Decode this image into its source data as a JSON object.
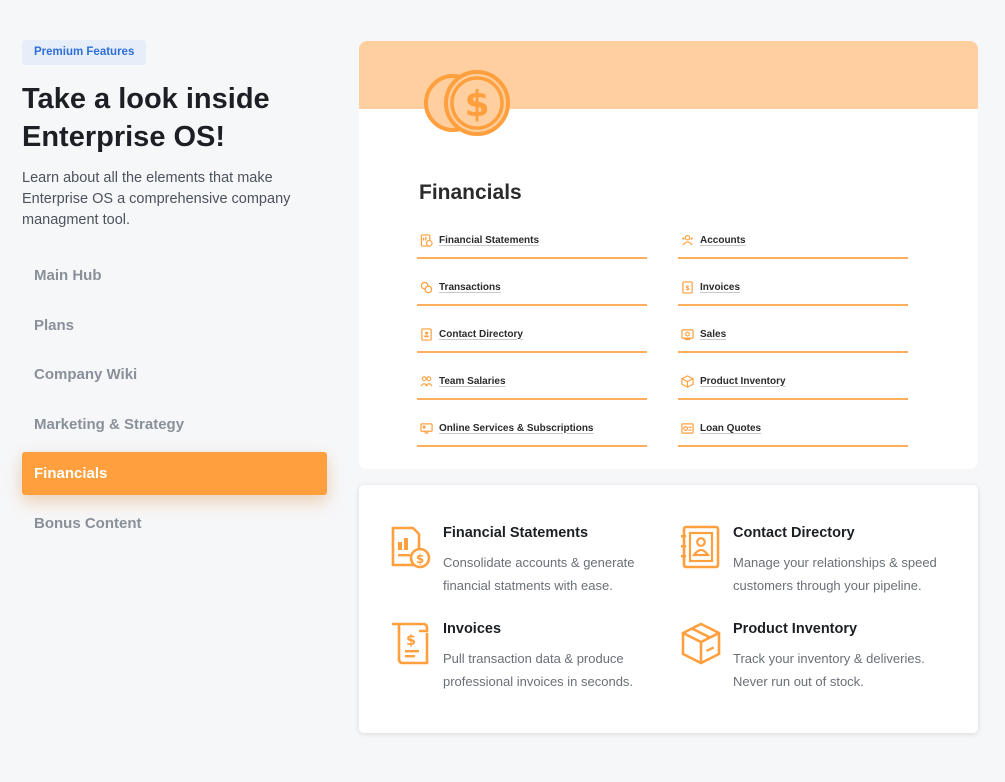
{
  "badge": "Premium Features",
  "heading": "Take a look inside Enterprise OS!",
  "intro": "Learn about all the elements that make Enterprise OS a comprehensive company managment tool.",
  "nav": [
    {
      "label": "Main Hub",
      "active": false
    },
    {
      "label": "Plans",
      "active": false
    },
    {
      "label": "Company Wiki",
      "active": false
    },
    {
      "label": "Marketing & Strategy",
      "active": false
    },
    {
      "label": "Financials",
      "active": true
    },
    {
      "label": "Bonus Content",
      "active": false
    }
  ],
  "preview": {
    "icon": "dollar-coin-icon",
    "title": "Financials",
    "links_left": [
      {
        "label": "Financial Statements",
        "icon": "statement-icon"
      },
      {
        "label": "Transactions",
        "icon": "coins-icon"
      },
      {
        "label": "Contact Directory",
        "icon": "contact-book-icon"
      },
      {
        "label": "Team Salaries",
        "icon": "team-icon"
      },
      {
        "label": "Online Services & Subscriptions",
        "icon": "screen-icon"
      }
    ],
    "links_right": [
      {
        "label": "Accounts",
        "icon": "accounts-icon"
      },
      {
        "label": "Invoices",
        "icon": "invoice-icon"
      },
      {
        "label": "Sales",
        "icon": "sales-icon"
      },
      {
        "label": "Product Inventory",
        "icon": "box-icon"
      },
      {
        "label": "Loan Quotes",
        "icon": "loan-icon"
      }
    ]
  },
  "features": [
    {
      "title": "Financial Statements",
      "desc": "Consolidate accounts & generate financial statments with ease.",
      "icon": "financial-statement-icon"
    },
    {
      "title": "Contact Directory",
      "desc": "Manage your relationships & speed customers through your pipeline.",
      "icon": "contact-directory-icon"
    },
    {
      "title": "Invoices",
      "desc": "Pull transaction data & produce professional invoices in seconds.",
      "icon": "invoice-scroll-icon"
    },
    {
      "title": "Product Inventory",
      "desc": "Track your inventory & deliveries. Never run out of stock.",
      "icon": "inventory-box-icon"
    }
  ],
  "colors": {
    "accent": "#ff9f3d",
    "banner": "#ffcf9f",
    "badge_bg": "#e6eef9",
    "badge_text": "#2f6fd6"
  }
}
